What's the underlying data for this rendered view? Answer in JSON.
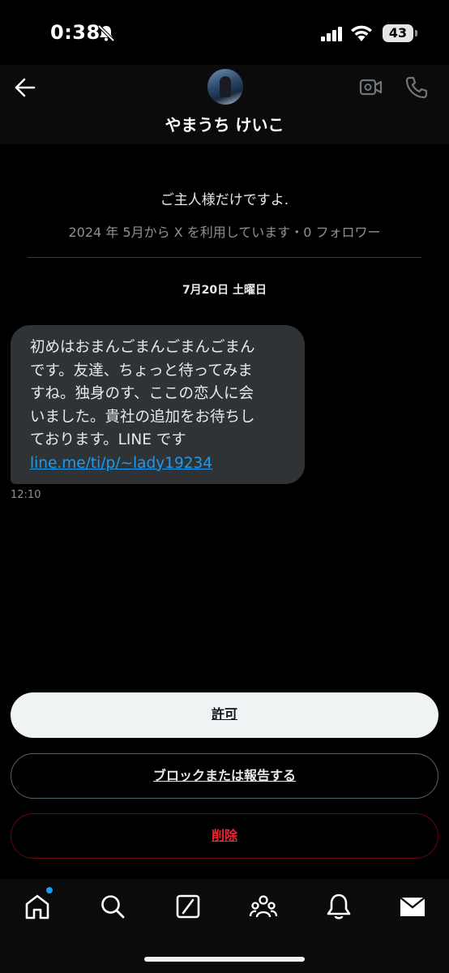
{
  "status_bar": {
    "time": "0:38",
    "battery": "43"
  },
  "header": {
    "name": "やまうち けいこ",
    "icons": [
      "back-arrow-icon",
      "avatar",
      "video-call-icon",
      "phone-icon"
    ]
  },
  "profile": {
    "description": "ご主人様だけですよ.",
    "meta": "2024 年 5月から X を利用しています・0 フォロワー"
  },
  "conversation": {
    "date": "7月20日 土曜日",
    "message": {
      "text": "初めはおまんごまんごまんごまん\nです。友達、ちょっと待ってみま\nすね。独身のす、ここの恋人に会\nいました。貴社の追加をお待ちし\nております。LINE です",
      "link": "line.me/ti/p/~lady19234",
      "time": "12:10"
    }
  },
  "actions": {
    "allow": "許可",
    "block_report": "ブロックまたは報告する",
    "delete": "削除"
  },
  "tab_bar": {
    "items": [
      "home-icon",
      "search-icon",
      "grok-icon",
      "communities-icon",
      "notifications-icon",
      "messages-icon"
    ]
  },
  "colors": {
    "accent": "#1d9bf0",
    "danger": "#f4212e",
    "bubble": "#2f3336",
    "background": "#000000"
  }
}
